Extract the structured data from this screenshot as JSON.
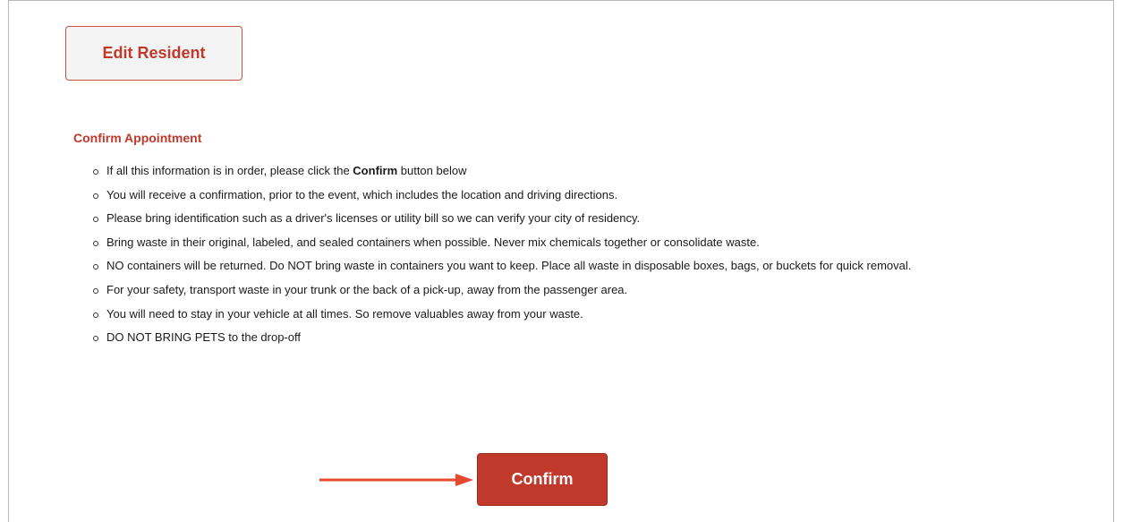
{
  "edit_resident_button": {
    "label": "Edit Resident"
  },
  "confirm_section": {
    "title": "Confirm Appointment",
    "items": [
      {
        "pre": "If all this information is in order, please click the ",
        "bold": "Confirm",
        "post": " button below"
      },
      {
        "text": "You will receive a confirmation, prior to the event, which includes the location and driving directions."
      },
      {
        "text": "Please bring identification such as a driver's licenses or utility bill so we can verify your city of residency."
      },
      {
        "text": "Bring waste in their original, labeled, and sealed containers when possible. Never mix chemicals together or consolidate waste."
      },
      {
        "text": "NO containers will be returned. Do NOT bring waste in containers you want to keep. Place all waste in disposable boxes, bags, or buckets for quick removal."
      },
      {
        "text": "For your safety, transport waste in your trunk or the back of a pick-up, away from the passenger area."
      },
      {
        "text": "You will need to stay in your vehicle at all times. So remove valuables away from your waste."
      },
      {
        "text": "DO NOT BRING PETS to the drop-off"
      }
    ]
  },
  "confirm_button": {
    "label": "Confirm"
  },
  "annotation": {
    "arrow_icon": "right-arrow-icon",
    "arrow_color": "#e8482f"
  },
  "colors": {
    "accent": "#c0392b",
    "text": "#1a1a1a",
    "border": "#b8b8b8"
  }
}
